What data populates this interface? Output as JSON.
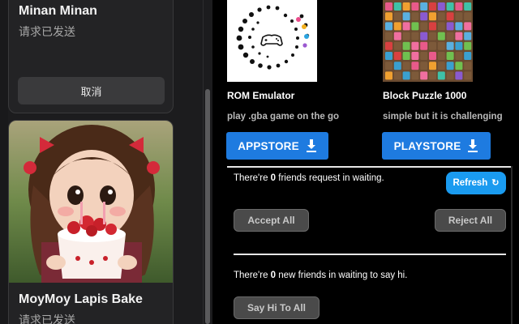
{
  "left_panel": {
    "card1": {
      "name": "Minan Minan",
      "status": "请求已发送",
      "cancel_label": "取消"
    },
    "card2": {
      "name": "MoyMoy Lapis Bake",
      "status": "请求已发送"
    }
  },
  "apps": [
    {
      "name": "ROM Emulator",
      "description": "play .gba game on the go",
      "button_label": "APPSTORE",
      "icon": "download-icon"
    },
    {
      "name": "Block Puzzle 1000",
      "description": "simple but it is challenging",
      "button_label": "PLAYSTORE",
      "icon": "download-icon"
    }
  ],
  "friends": {
    "requests_prefix": "There're ",
    "requests_count": "0",
    "requests_suffix": " friends request in waiting.",
    "refresh_label": "Refresh",
    "accept_all_label": "Accept All",
    "reject_all_label": "Reject All",
    "new_prefix": "There're ",
    "new_count": "0",
    "new_suffix": " new friends in waiting to say hi.",
    "say_hi_label": "Say Hi To All"
  },
  "colors": {
    "primary_button": "#1e7be0",
    "refresh_button": "#1a9bf0",
    "disabled_button": "#4a4a4a"
  }
}
